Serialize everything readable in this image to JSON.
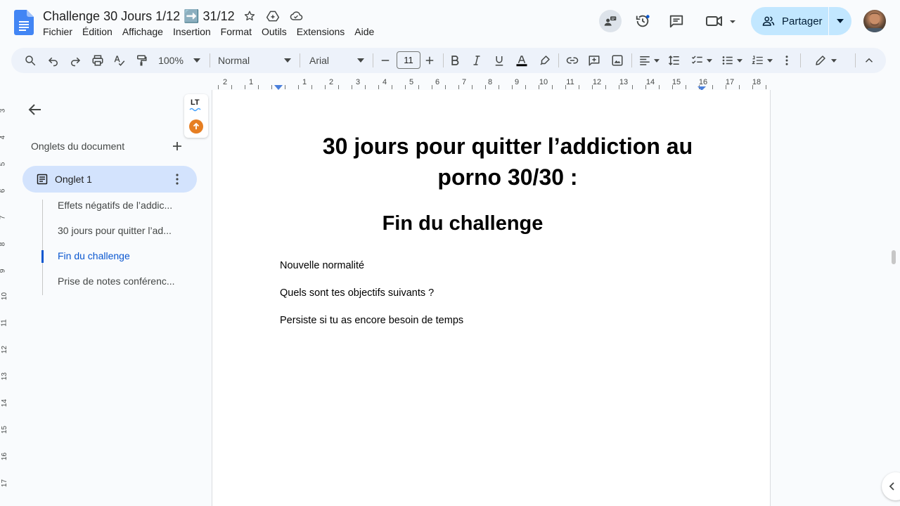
{
  "header": {
    "title": "Challenge 30 Jours 1/12 ➡️ 31/12",
    "menu": [
      "Fichier",
      "Édition",
      "Affichage",
      "Insertion",
      "Format",
      "Outils",
      "Extensions",
      "Aide"
    ],
    "share_label": "Partager"
  },
  "toolbar": {
    "zoom": "100%",
    "style": "Normal",
    "font": "Arial",
    "font_size": "11"
  },
  "ruler": {
    "top": [
      "2",
      "1",
      "1",
      "2",
      "3",
      "4",
      "5",
      "6",
      "7",
      "8",
      "9",
      "10",
      "11",
      "12",
      "13",
      "14",
      "15",
      "16",
      "17",
      "18"
    ],
    "left": [
      "3",
      "4",
      "5",
      "6",
      "7",
      "8",
      "9",
      "10",
      "11",
      "12",
      "13",
      "14",
      "15",
      "16",
      "17"
    ]
  },
  "sidebar": {
    "heading": "Onglets du document",
    "tab_label": "Onglet 1",
    "outline": [
      {
        "label": "Effets négatifs de l’addic...",
        "active": false
      },
      {
        "label": "30 jours pour quitter l’ad...",
        "active": false
      },
      {
        "label": "Fin du challenge",
        "active": true
      },
      {
        "label": "Prise de notes conférenc...",
        "active": false
      }
    ]
  },
  "widget": {
    "lt_label": "LT"
  },
  "document": {
    "heading1_line1": "30 jours pour quitter l’addiction au",
    "heading1_line2": "porno 30/30 :",
    "heading2": "Fin du challenge",
    "paragraphs": [
      "Nouvelle normalité",
      "Quels sont tes objectifs suivants ?",
      "Persiste si tu as encore besoin de temps"
    ]
  },
  "colors": {
    "accent": "#0b57d0",
    "share_bg": "#c2e7ff",
    "toolbar_bg": "#edf2fa",
    "tab_active_bg": "#d3e3fd"
  }
}
